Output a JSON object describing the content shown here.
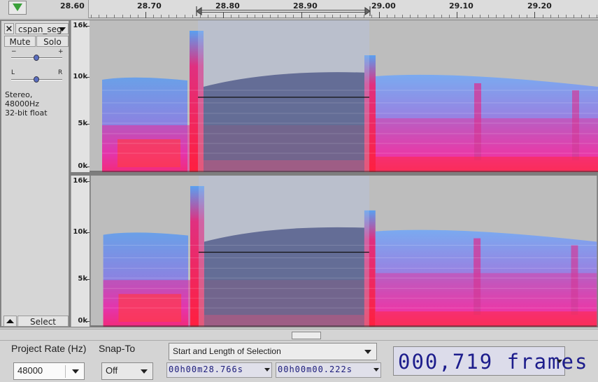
{
  "ruler": {
    "labels": [
      "28.60",
      "28.70",
      "28.80",
      "28.90",
      "29.00",
      "29.10",
      "29.20"
    ]
  },
  "track": {
    "name": "cspan_seg",
    "close_glyph": "×",
    "mute_label": "Mute",
    "solo_label": "Solo",
    "gain_minus": "−",
    "gain_plus": "+",
    "pan_left": "L",
    "pan_right": "R",
    "info_line1": "Stereo, 48000Hz",
    "info_line2": "32-bit float",
    "select_label": "Select",
    "collapse_icon": "triangle-up-icon"
  },
  "spectrogram": {
    "freq_labels": [
      "16k",
      "10k",
      "5k",
      "0k"
    ],
    "channels": 2
  },
  "toolbar": {
    "project_rate_label": "Project Rate (Hz)",
    "project_rate_value": "48000",
    "snap_to_label": "Snap-To",
    "snap_to_value": "Off",
    "selection_mode": "Start and Length of Selection",
    "start_time": "00h00m28.766s",
    "length_time": "00h00m00.222s",
    "frames_readout": "000,719 frames"
  },
  "colors": {
    "accent_play": "#3aa03a",
    "readout_text": "#1d1d8c",
    "selection_overlay": "#b4c4e8"
  }
}
